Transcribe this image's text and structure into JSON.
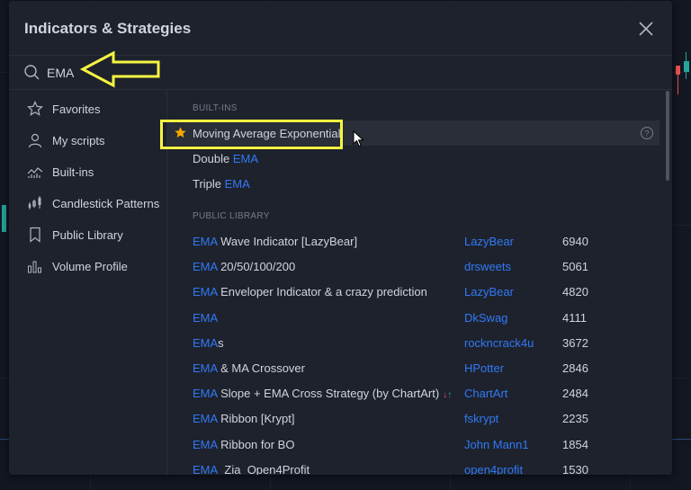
{
  "dialog": {
    "title": "Indicators & Strategies",
    "close_icon": "close-icon"
  },
  "search": {
    "value": "EMA",
    "icon": "search-icon"
  },
  "sidebar": {
    "items": [
      {
        "label": "Favorites",
        "icon": "star-outline-icon"
      },
      {
        "label": "My scripts",
        "icon": "user-icon"
      },
      {
        "label": "Built-ins",
        "icon": "chart-line-icon"
      },
      {
        "label": "Candlestick Patterns",
        "icon": "candlestick-icon"
      },
      {
        "label": "Public Library",
        "icon": "bookmark-icon"
      },
      {
        "label": "Volume Profile",
        "icon": "volume-profile-icon"
      }
    ]
  },
  "builtins": {
    "header": "BUILT-INS",
    "items": [
      {
        "prefix": "",
        "match": "",
        "suffix": "Moving Average Exponential",
        "favorite": true
      },
      {
        "prefix": "Double ",
        "match": "EMA",
        "suffix": ""
      },
      {
        "prefix": "Triple ",
        "match": "EMA",
        "suffix": ""
      }
    ]
  },
  "public_library": {
    "header": "PUBLIC LIBRARY",
    "items": [
      {
        "match": "EMA",
        "suffix": " Wave Indicator [LazyBear]",
        "author": "LazyBear",
        "likes": "6940"
      },
      {
        "match": "EMA",
        "suffix": " 20/50/100/200",
        "author": "drsweets",
        "likes": "5061"
      },
      {
        "match": "EMA",
        "suffix": " Enveloper Indicator & a crazy prediction",
        "author": "LazyBear",
        "likes": "4820"
      },
      {
        "match": "EMA",
        "suffix": "",
        "author": "DkSwag",
        "likes": "4111"
      },
      {
        "match": "EMA",
        "suffix": "s",
        "author": "rockncrack4u",
        "likes": "3672"
      },
      {
        "match": "EMA",
        "suffix": " & MA Crossover",
        "author": "HPotter",
        "likes": "2846"
      },
      {
        "match": "EMA",
        "suffix": " Slope + EMA Cross Strategy (by ChartArt)",
        "author": "ChartArt",
        "likes": "2484",
        "strategy_arrows": true
      },
      {
        "match": "EMA",
        "suffix": " Ribbon [Krypt]",
        "author": "fskrypt",
        "likes": "2235"
      },
      {
        "match": "EMA",
        "suffix": " Ribbon for BO",
        "author": "John Mann1",
        "likes": "1854"
      },
      {
        "match": "EMA",
        "suffix": "_Zia_Open4Profit",
        "author": "open4profit",
        "likes": "1530"
      }
    ]
  },
  "colors": {
    "accent": "#3179f5",
    "highlight_box": "#f5f542",
    "favorite_star": "#f7a600"
  }
}
